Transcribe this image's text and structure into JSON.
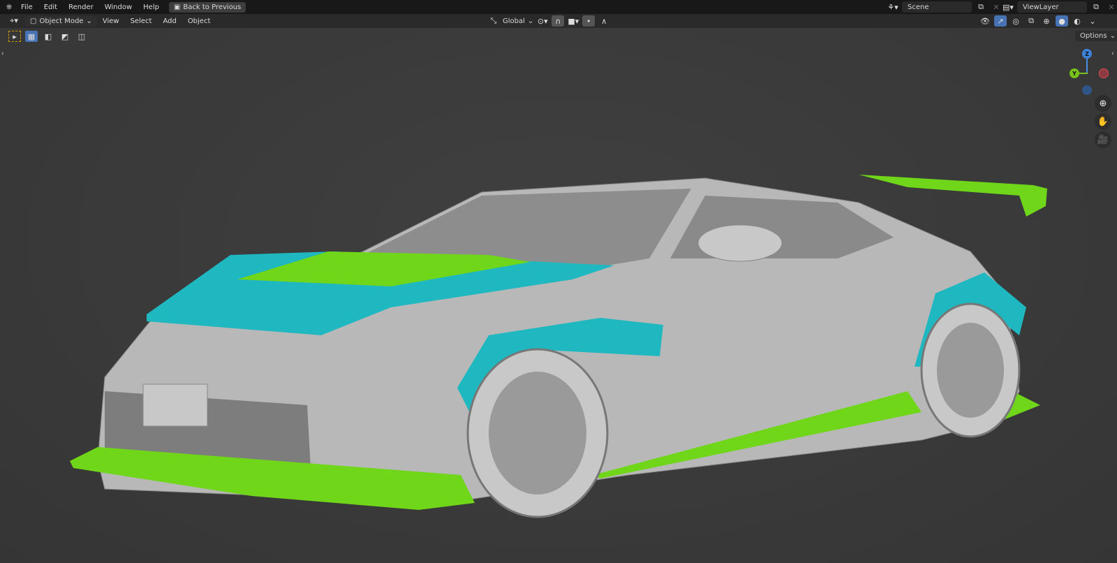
{
  "menu": {
    "items": [
      "File",
      "Edit",
      "Render",
      "Window",
      "Help"
    ],
    "back_button": "Back to Previous"
  },
  "scene": {
    "name": "Scene",
    "view_layer": "ViewLayer"
  },
  "header": {
    "mode": "Object Mode",
    "menus": [
      "View",
      "Select",
      "Add",
      "Object"
    ],
    "transform_orientation": "Global",
    "options": "Options"
  },
  "gizmo": {
    "z": "Z",
    "y": "Y"
  },
  "colors": {
    "accent": "#4772b3",
    "cyan": "#1fb8c0",
    "green": "#6fd61a",
    "body": "#b9b9b9"
  }
}
